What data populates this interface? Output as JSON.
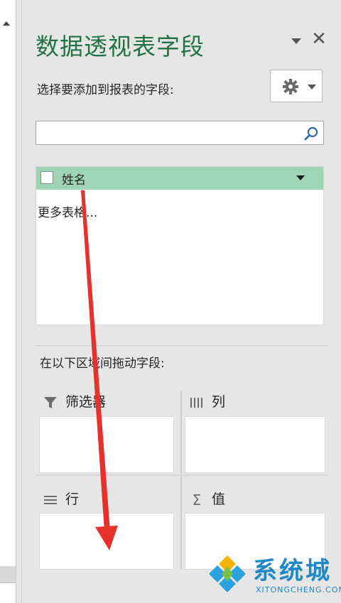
{
  "pane": {
    "title": "数据透视表字段",
    "choose_fields_label": "选择要添加到报表的字段:",
    "search": {
      "value": "",
      "placeholder": ""
    }
  },
  "fields": [
    {
      "label": "姓名",
      "checked": false
    }
  ],
  "more_tables": "更多表格...",
  "drag_label": "在以下区域间拖动字段:",
  "areas": {
    "filters": {
      "label": "筛选器",
      "icon": "filter-icon"
    },
    "columns": {
      "label": "列",
      "icon": "columns-icon"
    },
    "rows": {
      "label": "行",
      "icon": "rows-icon"
    },
    "values": {
      "label": "值",
      "icon": "sigma-icon"
    }
  },
  "values_icon_glyph": "Σ",
  "close_glyph": "✕",
  "watermark": {
    "text": "系统城",
    "sub": "XITONGCHENG.COM"
  },
  "colors": {
    "accent": "#217346",
    "field_highlight": "#9fd5b7",
    "annotation_arrow": "#e8312a",
    "watermark": "#1e88c8"
  }
}
